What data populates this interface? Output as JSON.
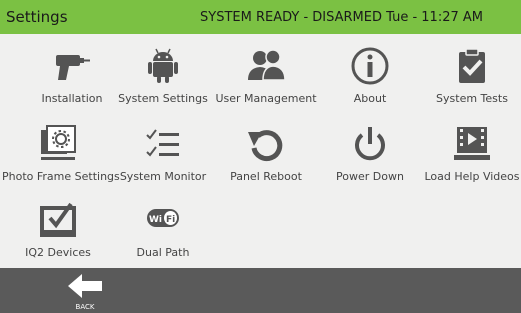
{
  "header": {
    "title": "Settings",
    "status": "SYSTEM READY - DISARMED",
    "time": "Tue - 11:27 AM"
  },
  "tiles": [
    {
      "label": "Installation",
      "icon": "drill-icon"
    },
    {
      "label": "System Settings",
      "icon": "android-icon"
    },
    {
      "label": "User Management",
      "icon": "users-icon"
    },
    {
      "label": "About",
      "icon": "info-icon"
    },
    {
      "label": "System Tests",
      "icon": "clipboard-check-icon"
    },
    {
      "label": "Photo Frame Settings",
      "icon": "photo-frame-icon"
    },
    {
      "label": "System Monitor",
      "icon": "checklist-icon"
    },
    {
      "label": "Panel Reboot",
      "icon": "reboot-icon"
    },
    {
      "label": "Power Down",
      "icon": "power-icon"
    },
    {
      "label": "Load Help Videos",
      "icon": "film-icon"
    },
    {
      "label": "IQ2 Devices",
      "icon": "iq2-device-icon"
    },
    {
      "label": "Dual Path",
      "icon": "wifi-badge-icon"
    }
  ],
  "footer": {
    "back_label": "BACK"
  },
  "colors": {
    "header": "#7bc143",
    "footer": "#5a5a5a",
    "icon": "#545454"
  }
}
